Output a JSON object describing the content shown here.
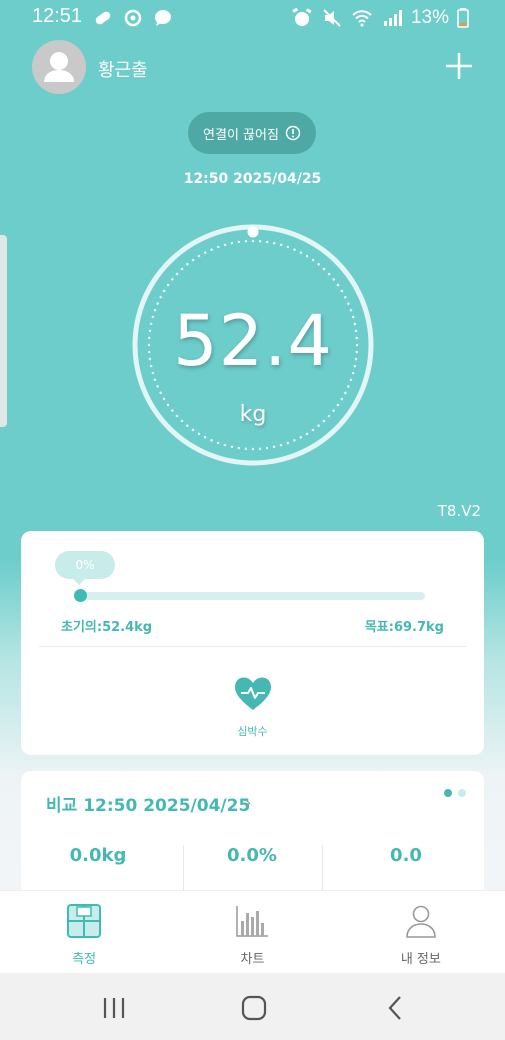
{
  "status_bar": {
    "time": "12:51",
    "battery": "13%",
    "left_icons": [
      "pill-icon",
      "sync-icon",
      "chat-icon"
    ],
    "right_icons": [
      "alarm-icon",
      "mute-icon",
      "wifi-icon",
      "signal-icon",
      "battery-icon"
    ]
  },
  "header": {
    "username": "황근출"
  },
  "connection": {
    "status_text": "연결이 끊어짐"
  },
  "measurement": {
    "datetime": "12:50 2025/04/25",
    "weight": "52.4",
    "unit": "kg",
    "device_model": "T8.V2"
  },
  "progress": {
    "percent_label": "0%",
    "percent": 0,
    "initial_label": "초기의:52.4kg",
    "goal_label": "목표:69.7kg"
  },
  "heart_rate": {
    "label": "심박수"
  },
  "comparison": {
    "title": "비교 12:50 2025/04/25",
    "chevron": "›",
    "values": [
      "0.0kg",
      "0.0%",
      "0.0"
    ]
  },
  "bottom_nav": [
    {
      "label": "측정",
      "icon": "scale-icon",
      "active": true
    },
    {
      "label": "차트",
      "icon": "chart-icon",
      "active": false
    },
    {
      "label": "내 정보",
      "icon": "profile-icon",
      "active": false
    }
  ],
  "colors": {
    "accent": "#45b8b3",
    "background": "#6ccdcb",
    "pill": "#4ea8a3"
  }
}
